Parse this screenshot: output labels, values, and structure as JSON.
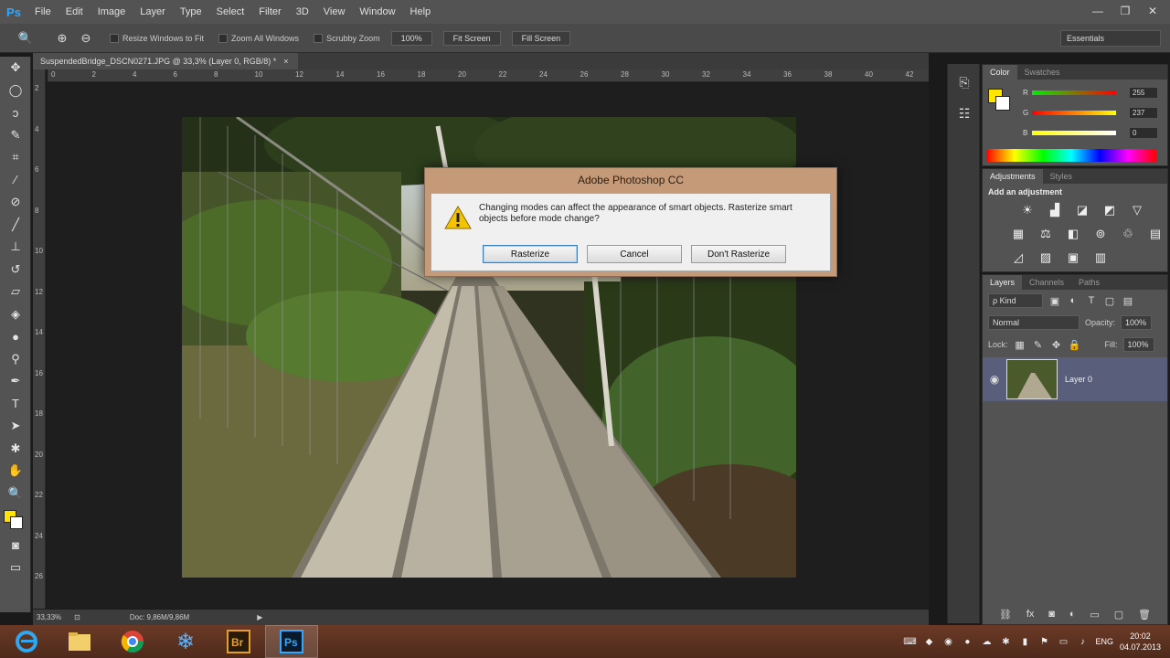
{
  "app": {
    "logo": "Ps"
  },
  "menu": [
    "File",
    "Edit",
    "Image",
    "Layer",
    "Type",
    "Select",
    "Filter",
    "3D",
    "View",
    "Window",
    "Help"
  ],
  "options_bar": {
    "checkboxes": [
      "Resize Windows to Fit",
      "Zoom All Windows",
      "Scrubby Zoom"
    ],
    "buttons": [
      "100%",
      "Fit Screen",
      "Fill Screen"
    ],
    "workspace": "Essentials"
  },
  "document": {
    "tab_title": "SuspendedBridge_DSCN0271.JPG @ 33,3% (Layer 0, RGB/8) *",
    "close": "×"
  },
  "ruler_h": [
    "0",
    "2",
    "4",
    "6",
    "8",
    "10",
    "12",
    "14",
    "16",
    "18",
    "20",
    "22",
    "24",
    "26",
    "28",
    "30",
    "32",
    "34",
    "36",
    "38",
    "40",
    "42"
  ],
  "ruler_v": [
    "2",
    "4",
    "6",
    "8",
    "10",
    "12",
    "14",
    "16",
    "18",
    "20",
    "22",
    "24",
    "26"
  ],
  "status": {
    "zoom": "33,33%",
    "doc": "Doc: 9,86M/9,86M"
  },
  "dialog": {
    "title": "Adobe Photoshop CC",
    "message": "Changing modes can affect the appearance of smart objects.  Rasterize smart objects before mode change?",
    "buttons": {
      "rasterize": "Rasterize",
      "cancel": "Cancel",
      "dont": "Don't Rasterize"
    }
  },
  "color_panel": {
    "tabs": [
      "Color",
      "Swatches"
    ],
    "r_label": "R",
    "g_label": "G",
    "b_label": "B",
    "r": "255",
    "g": "237",
    "b": "0"
  },
  "adjustments_panel": {
    "tabs": [
      "Adjustments",
      "Styles"
    ],
    "title": "Add an adjustment"
  },
  "layers_panel": {
    "tabs": [
      "Layers",
      "Channels",
      "Paths"
    ],
    "filter": "ρ Kind",
    "blend_mode": "Normal",
    "opacity_label": "Opacity:",
    "opacity": "100%",
    "lock_label": "Lock:",
    "fill_label": "Fill:",
    "fill": "100%",
    "layer_name": "Layer 0"
  },
  "taskbar": {
    "language": "ENG",
    "time": "20:02",
    "date": "04.07.2013"
  },
  "colors": {
    "accent": "#31a8ff",
    "foreground": "#ffe500",
    "background": "#ffffff",
    "taskbar": "#5a3020"
  }
}
